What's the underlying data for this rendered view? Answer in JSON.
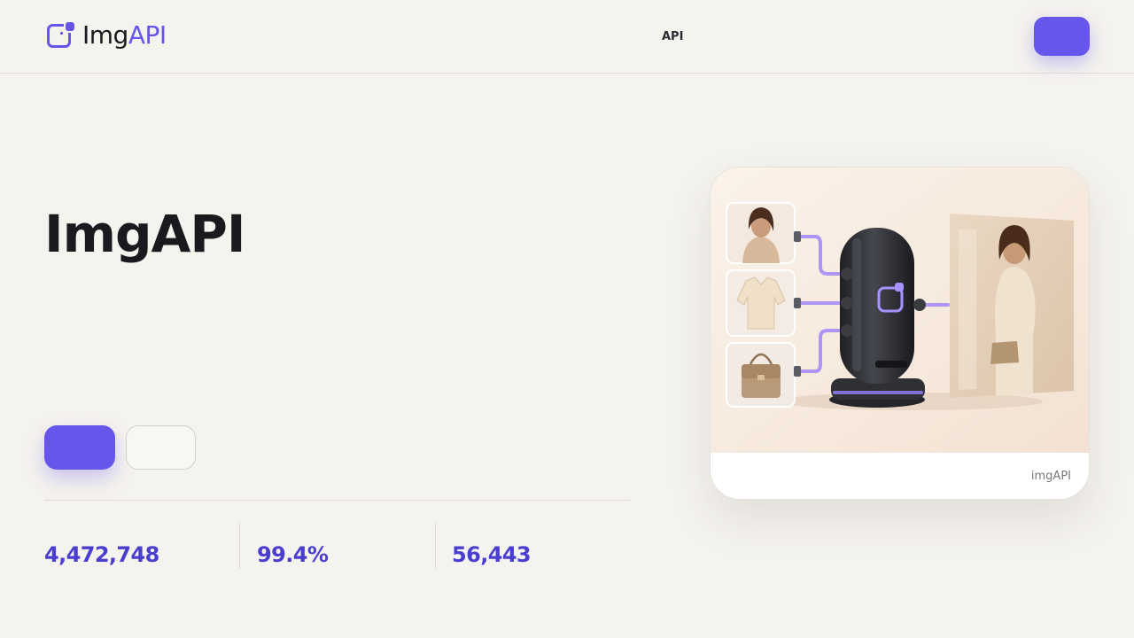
{
  "header": {
    "logo": {
      "icon": "imgapi-logo-icon",
      "text_dark": "Img",
      "text_accent": "API"
    },
    "nav": [
      {
        "label": "API"
      }
    ],
    "cta_label": ""
  },
  "hero": {
    "title": "ImgAPI",
    "primary_button_label": "",
    "secondary_button_label": ""
  },
  "stats": [
    {
      "value": "4,472,748"
    },
    {
      "value": "99.4%"
    },
    {
      "value": "56,443"
    }
  ],
  "showcase": {
    "image": "product-compositing-illustration",
    "caption": "imgAPI"
  },
  "colors": {
    "accent": "#6656ec",
    "accent_dark": "#4a3ecf",
    "background": "#f5f3ee",
    "text": "#1a1a1f"
  }
}
